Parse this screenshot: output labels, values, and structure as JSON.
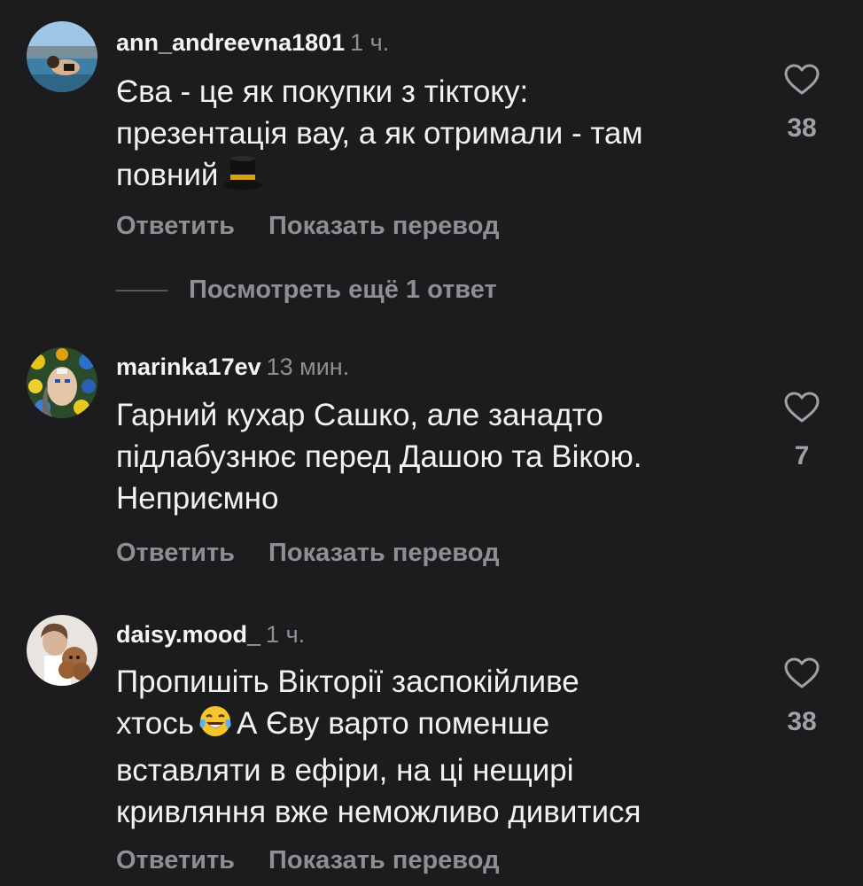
{
  "comments": [
    {
      "username": "ann_andreevna1801",
      "time": "1 ч.",
      "lines": [
        "Єва - це як покупки з тіктоку:",
        "презентація вау, а як отримали - там",
        "повний"
      ],
      "emoji": "top-hat-emoji",
      "likes": "38",
      "reply_label": "Ответить",
      "translate_label": "Показать перевод"
    },
    {
      "username": "marinka17ev",
      "time": "13 мин.",
      "lines": [
        "Гарний кухар Сашко, але занадто",
        "підлабузнює перед Дашою та Вікою.",
        "Неприємно"
      ],
      "likes": "7",
      "reply_label": "Ответить",
      "translate_label": "Показать перевод"
    },
    {
      "username": "daisy.mood_",
      "time": "1 ч.",
      "lines": [
        "Пропишіть Вікторії заспокійливе",
        "хтось",
        "А Єву варто поменше",
        "вставляти в ефіри, на ці нещирі",
        "кривляння вже неможливо дивитися"
      ],
      "emoji": "laughing-tears-emoji",
      "likes": "38",
      "reply_label": "Ответить",
      "translate_label": "Показать перевод"
    }
  ],
  "more_replies": "Посмотреть ещё 1 ответ",
  "colors": {
    "background": "#1c1c1e",
    "text": "#f2f2f2",
    "secondary": "#8e8e93"
  }
}
